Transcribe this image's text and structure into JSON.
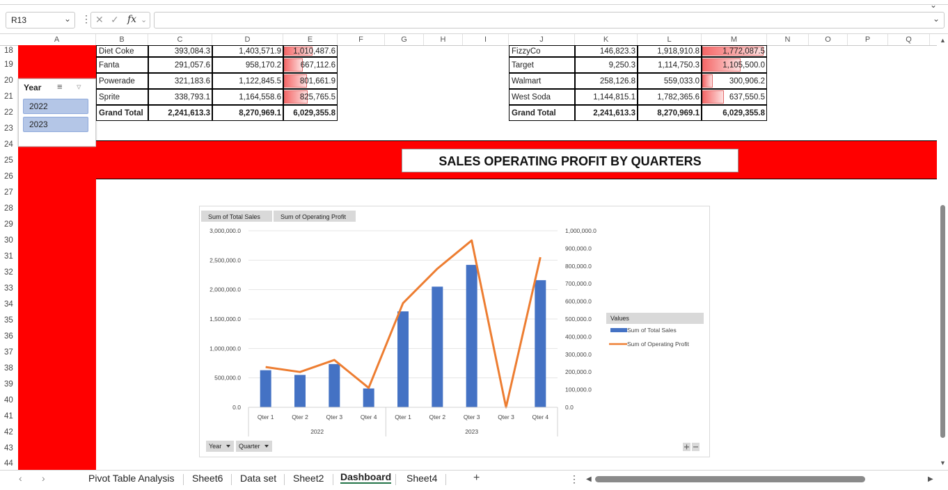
{
  "formula_bar": {
    "name_box": "R13",
    "fx_label": "fx",
    "formula": ""
  },
  "columns": [
    "A",
    "B",
    "C",
    "D",
    "E",
    "F",
    "G",
    "H",
    "I",
    "J",
    "K",
    "L",
    "M",
    "N",
    "O",
    "P",
    "Q"
  ],
  "rows": [
    "18",
    "19",
    "20",
    "21",
    "22",
    "23",
    "24",
    "25",
    "26",
    "27",
    "28",
    "29",
    "30",
    "31",
    "32",
    "33",
    "34",
    "35",
    "36",
    "37",
    "38",
    "39",
    "40",
    "41",
    "42",
    "43",
    "44"
  ],
  "table_left": {
    "rows": [
      {
        "label": "Diet Coke",
        "c": "393,084.3",
        "d": "1,403,571.9",
        "e": "1,010,487.6",
        "fill": 0.56
      },
      {
        "label": "Fanta",
        "c": "291,057.6",
        "d": "958,170.2",
        "e": "667,112.6",
        "fill": 0.37
      },
      {
        "label": "Powerade",
        "c": "321,183.6",
        "d": "1,122,845.5",
        "e": "801,661.9",
        "fill": 0.45
      },
      {
        "label": "Sprite",
        "c": "338,793.1",
        "d": "1,164,558.6",
        "e": "825,765.5",
        "fill": 0.46
      }
    ],
    "total": {
      "label": "Grand Total",
      "c": "2,241,613.3",
      "d": "8,270,969.1",
      "e": "6,029,355.8"
    }
  },
  "table_right": {
    "rows": [
      {
        "label": "FizzyCo",
        "k": "146,823.3",
        "l": "1,918,910.8",
        "m": "1,772,087.5",
        "fill": 0.98
      },
      {
        "label": "Target",
        "k": "9,250.3",
        "l": "1,114,750.3",
        "m": "1,105,500.0",
        "fill": 0.61
      },
      {
        "label": "Walmart",
        "k": "258,126.8",
        "l": "559,033.0",
        "m": "300,906.2",
        "fill": 0.17
      },
      {
        "label": "West Soda",
        "k": "1,144,815.1",
        "l": "1,782,365.6",
        "m": "637,550.5",
        "fill": 0.35
      }
    ],
    "total": {
      "label": "Grand Total",
      "k": "2,241,613.3",
      "l": "8,270,969.1",
      "m": "6,029,355.8"
    }
  },
  "slicer": {
    "title": "Year",
    "items": [
      "2022",
      "2023"
    ]
  },
  "banner": {
    "title": "SALES OPERATING PROFIT BY QUARTERS",
    "color": "#ff0000"
  },
  "chart_data": {
    "type": "bar",
    "field_buttons": [
      "Sum of Total Sales",
      "Sum of Operating Profit"
    ],
    "axis_buttons": [
      "Year",
      "Quarter"
    ],
    "categories": [
      "Qter 1",
      "Qter 2",
      "Qter 3",
      "Qter 4",
      "Qter 1",
      "Qter 2",
      "Qter 3",
      "Qter 4"
    ],
    "groups": [
      {
        "name": "2022",
        "count": 4
      },
      {
        "name": "2023",
        "count": 5
      }
    ],
    "x_labels": [
      "Qter 1",
      "Qter 2",
      "Qter 3",
      "Qter 4",
      "Qter 1",
      "Qter 2",
      "Qter 3",
      "Qter 3",
      "Qter 4"
    ],
    "series": [
      {
        "name": "Sum of Total Sales",
        "axis": "left",
        "type": "bar",
        "color": "#4472c4",
        "values": [
          630000,
          550000,
          735000,
          320000,
          1630000,
          2050000,
          2420000,
          5000,
          2160000
        ]
      },
      {
        "name": "Sum of Operating Profit",
        "axis": "right",
        "type": "line",
        "color": "#ed7d31",
        "values": [
          228000,
          200000,
          268000,
          110000,
          590000,
          785000,
          945000,
          0,
          850000
        ]
      }
    ],
    "y_left": {
      "ticks": [
        "3,000,000.0",
        "2,500,000.0",
        "2,000,000.0",
        "1,500,000.0",
        "1,000,000.0",
        "500,000.0",
        "0.0"
      ],
      "range": [
        0,
        3000000
      ]
    },
    "y_right": {
      "ticks": [
        "1,000,000.0",
        "900,000.0",
        "800,000.0",
        "700,000.0",
        "600,000.0",
        "500,000.0",
        "400,000.0",
        "300,000.0",
        "200,000.0",
        "100,000.0",
        "0.0"
      ],
      "range": [
        0,
        1000000
      ]
    },
    "legend": {
      "title": "Values",
      "position": "right"
    }
  },
  "sheet_tabs": [
    "Pivot Table Analysis",
    "Sheet6",
    "Data set",
    "Sheet2",
    "Dashboard",
    "Sheet4"
  ],
  "active_tab": "Dashboard"
}
